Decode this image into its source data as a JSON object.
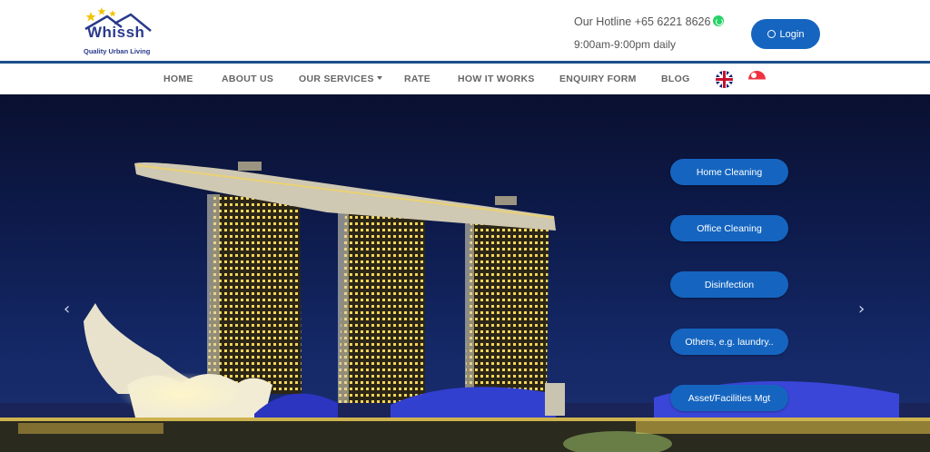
{
  "brand": {
    "name": "Whissh",
    "tagline": "Quality Urban Living"
  },
  "header": {
    "hotline": "Our Hotline +65 6221 8626",
    "hours": "9:00am-9:00pm daily",
    "login_label": "Login",
    "accent": "#1565c0"
  },
  "nav": {
    "items": [
      {
        "label": "HOME"
      },
      {
        "label": "ABOUT US"
      },
      {
        "label": "OUR SERVICES"
      },
      {
        "label": "RATE"
      },
      {
        "label": "HOW IT WORKS"
      },
      {
        "label": "ENQUIRY FORM"
      },
      {
        "label": "BLOG"
      }
    ],
    "languages": [
      {
        "icon": "uk-flag-icon"
      },
      {
        "icon": "singapore-flag-icon"
      }
    ]
  },
  "hero": {
    "prev_icon": "‹",
    "next_icon": "›",
    "services": [
      {
        "label": "Home Cleaning"
      },
      {
        "label": "Office Cleaning"
      },
      {
        "label": "Disinfection"
      },
      {
        "label": "Others, e.g. laundry.."
      },
      {
        "label": "Asset/Facilities Mgt"
      }
    ]
  }
}
